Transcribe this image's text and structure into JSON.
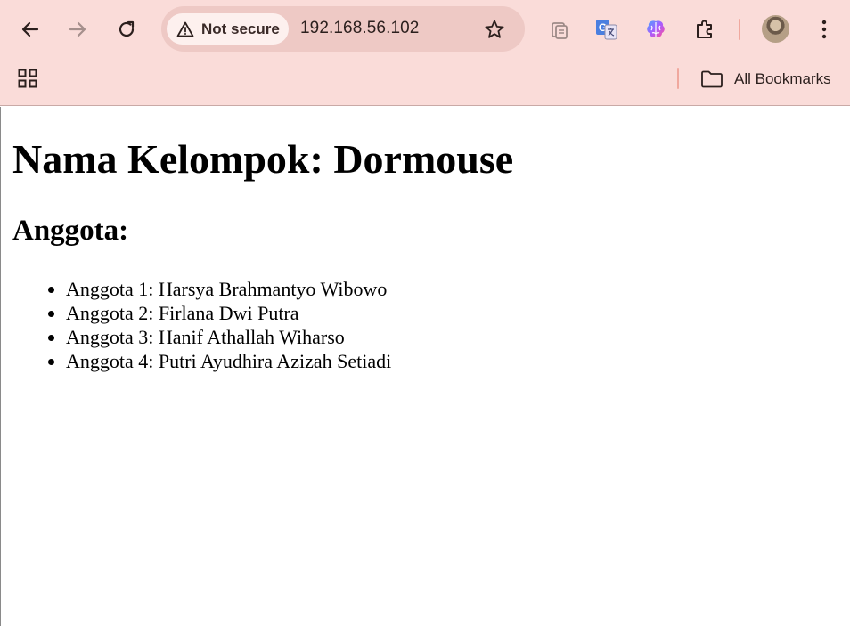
{
  "browser": {
    "security_label": "Not secure",
    "url": "192.168.56.102",
    "bookmarks": {
      "all_label": "All Bookmarks"
    },
    "colors": {
      "toolbar_bg": "#fadcd9",
      "omnibox_bg": "#eec9c5",
      "chip_bg": "#fdf0ee"
    },
    "icons": {
      "back": "arrow-left",
      "forward": "arrow-right",
      "reload": "refresh",
      "apps": "grid",
      "star": "star-outline",
      "extensions": [
        "clipboard-extension",
        "translate-extension",
        "brain-extension",
        "puzzle"
      ],
      "menu": "three-dots-vertical"
    }
  },
  "page": {
    "heading": "Nama Kelompok: Dormouse",
    "subheading": "Anggota:",
    "members": [
      "Anggota 1: Harsya Brahmantyo Wibowo",
      "Anggota 2: Firlana Dwi Putra",
      "Anggota 3: Hanif Athallah Wiharso",
      "Anggota 4: Putri Ayudhira Azizah Setiadi"
    ]
  }
}
